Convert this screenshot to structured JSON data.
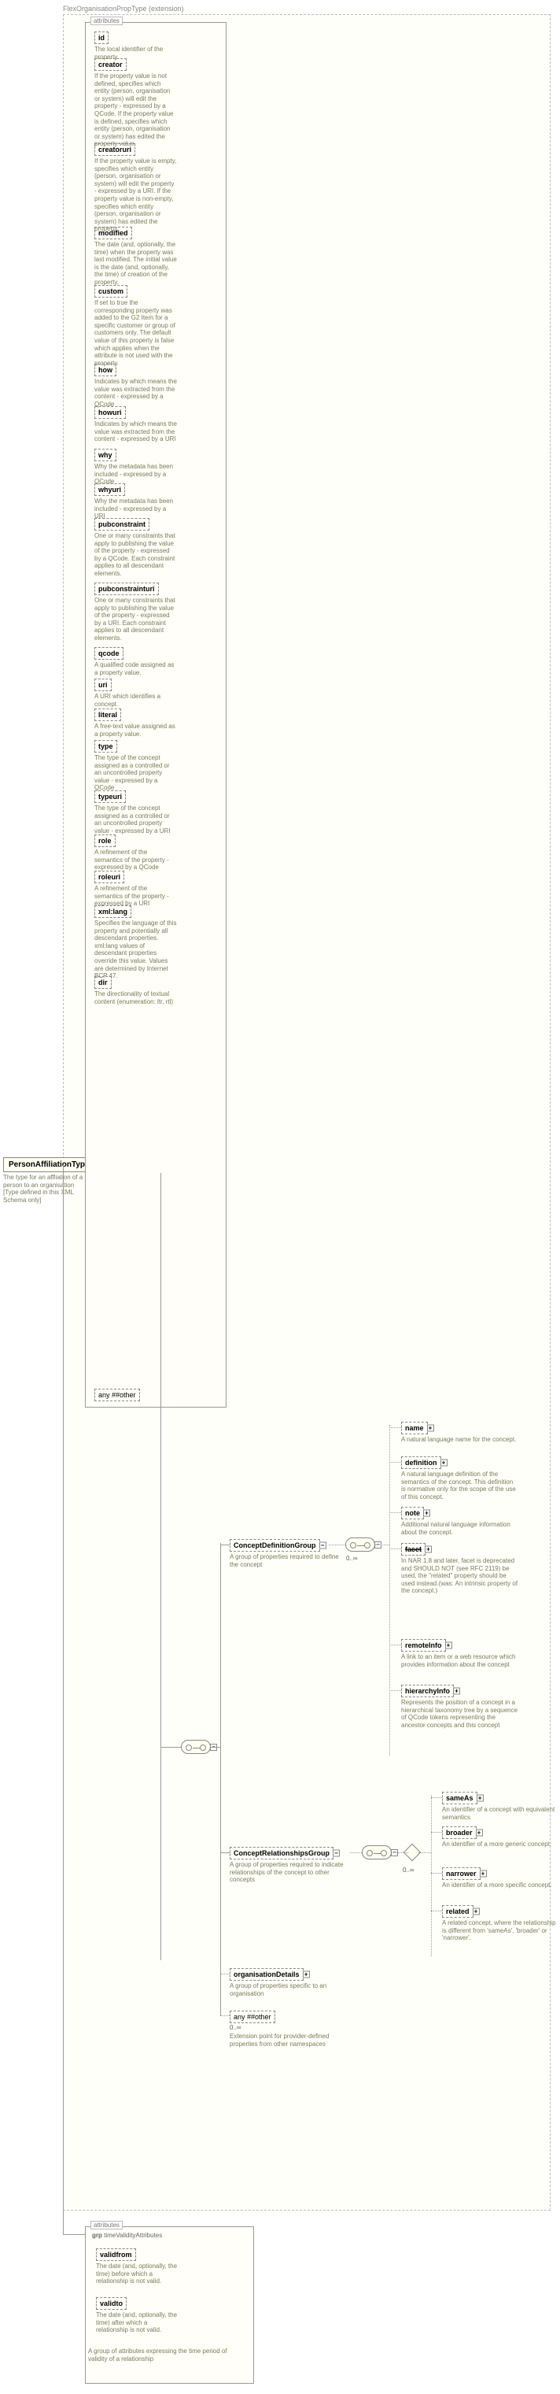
{
  "extension_header": "FlexOrganisationPropType (extension)",
  "root": {
    "label": "PersonAffiliationType",
    "desc": "The type for an affliation of a person to an organisation\n[Type defined in this XML Schema only]"
  },
  "attrs_label": "attributes",
  "attributes": [
    {
      "name": "id",
      "desc": "The local identifier of the property."
    },
    {
      "name": "creator",
      "desc": "If the property value is not defined, specifies which entity (person, organisation or system) will edit the property - expressed by a QCode. If the property value is defined, specifies which entity (person, organisation or system) has edited the property value."
    },
    {
      "name": "creatoruri",
      "desc": "If the property value is empty, specifies which entity (person, organisation or system) will edit the property - expressed by a URI. If the property value is non-empty, specifies which entity (person, organisation or system) has edited the property."
    },
    {
      "name": "modified",
      "desc": "The date (and, optionally, the time) when the property was last modified. The initial value is the date (and, optionally, the time) of creation of the property."
    },
    {
      "name": "custom",
      "desc": "If set to true the corresponding property was added to the G2 Item for a specific customer or group of customers only. The default value of this property is false which applies when the attribute is not used with the property."
    },
    {
      "name": "how",
      "desc": "Indicates by which means the value was extracted from the content - expressed by a QCode"
    },
    {
      "name": "howuri",
      "desc": "Indicates by which means the value was extracted from the content - expressed by a URI"
    },
    {
      "name": "why",
      "desc": "Why the metadata has been included - expressed by a QCode"
    },
    {
      "name": "whyuri",
      "desc": "Why the metadata has been included - expressed by a URI"
    },
    {
      "name": "pubconstraint",
      "desc": "One or many constraints that apply to publishing the value of the property - expressed by a QCode. Each constraint applies to all descendant elements."
    },
    {
      "name": "pubconstrainturi",
      "desc": "One or many constraints that apply to publishing the value of the property - expressed by a URI. Each constraint applies to all descendant elements."
    },
    {
      "name": "qcode",
      "desc": "A qualified code assigned as a property value."
    },
    {
      "name": "uri",
      "desc": "A URI which identifies a concept."
    },
    {
      "name": "literal",
      "desc": "A free-text value assigned as a property value."
    },
    {
      "name": "type",
      "desc": "The type of the concept assigned as a controlled or an uncontrolled property value - expressed by a QCode"
    },
    {
      "name": "typeuri",
      "desc": "The type of the concept assigned as a controlled or an uncontrolled property value - expressed by a URI"
    },
    {
      "name": "role",
      "desc": "A refinement of the semantics of the property - expressed by a QCode"
    },
    {
      "name": "roleuri",
      "desc": "A refinement of the semantics of the property - expressed by a URI"
    },
    {
      "name": "xml:lang",
      "desc": "Specifies the language of this property and potentially all descendant properties. xml:lang values of descendant properties override this value. Values are determined by Internet BCP 47."
    },
    {
      "name": "dir",
      "desc": "The directionality of textual content (enumeration: ltr, rtl)"
    }
  ],
  "any_other": "any ##other",
  "groups": {
    "cdg": {
      "label": "ConceptDefinitionGroup",
      "desc": "A group of properties required to define the concept",
      "occ": "0..∞"
    },
    "crg": {
      "label": "ConceptRelationshipsGroup",
      "desc": "A group of properties required to indicate relationships of the concept to other concepts",
      "occ": "0..∞"
    },
    "org": {
      "label": "organisationDetails",
      "desc": "A group of properties specific to an organisation"
    },
    "anyext": {
      "label": "any ##other",
      "desc": "Extension point for provider-defined properties from other namespaces",
      "occ": "0..∞"
    }
  },
  "cdg_children": [
    {
      "name": "name",
      "desc": "A natural language name for the concept."
    },
    {
      "name": "definition",
      "desc": "A natural language definition of the semantics of the concept. This definition is normative only for the scope of the use of this concept."
    },
    {
      "name": "note",
      "desc": "Additional natural language information about the concept."
    },
    {
      "name": "facet",
      "desc": "In NAR 1.8 and later, facet is deprecated and SHOULD NOT (see RFC 2119) be used, the \"related\" property should be used instead.(was: An intrinsic property of the concept.)"
    },
    {
      "name": "remoteInfo",
      "desc": "A link to an item or a web resource which provides information about the concept"
    },
    {
      "name": "hierarchyInfo",
      "desc": "Represents the position of a concept in a hierarchical taxonomy tree by a sequence of QCode tokens representing the ancestor concepts and this concept"
    }
  ],
  "crg_children": [
    {
      "name": "sameAs",
      "desc": "An identifier of a concept with equivalent semantics"
    },
    {
      "name": "broader",
      "desc": "An identifier of a more generic concept."
    },
    {
      "name": "narrower",
      "desc": "An identifier of a more specific concept."
    },
    {
      "name": "related",
      "desc": "A related concept, where the relationship is different from 'sameAs', 'broader' or 'narrower'."
    }
  ],
  "time_validity": {
    "group_label": "timeValidityAttributes",
    "attrs": [
      {
        "name": "validfrom",
        "desc": "The date (and, optionally, the time) before which a relationship is not valid."
      },
      {
        "name": "validto",
        "desc": "The date (and, optionally, the time) after which a relationship is not valid."
      }
    ],
    "group_desc": "A group of attributes expressing the time period of validity of a relationship"
  }
}
